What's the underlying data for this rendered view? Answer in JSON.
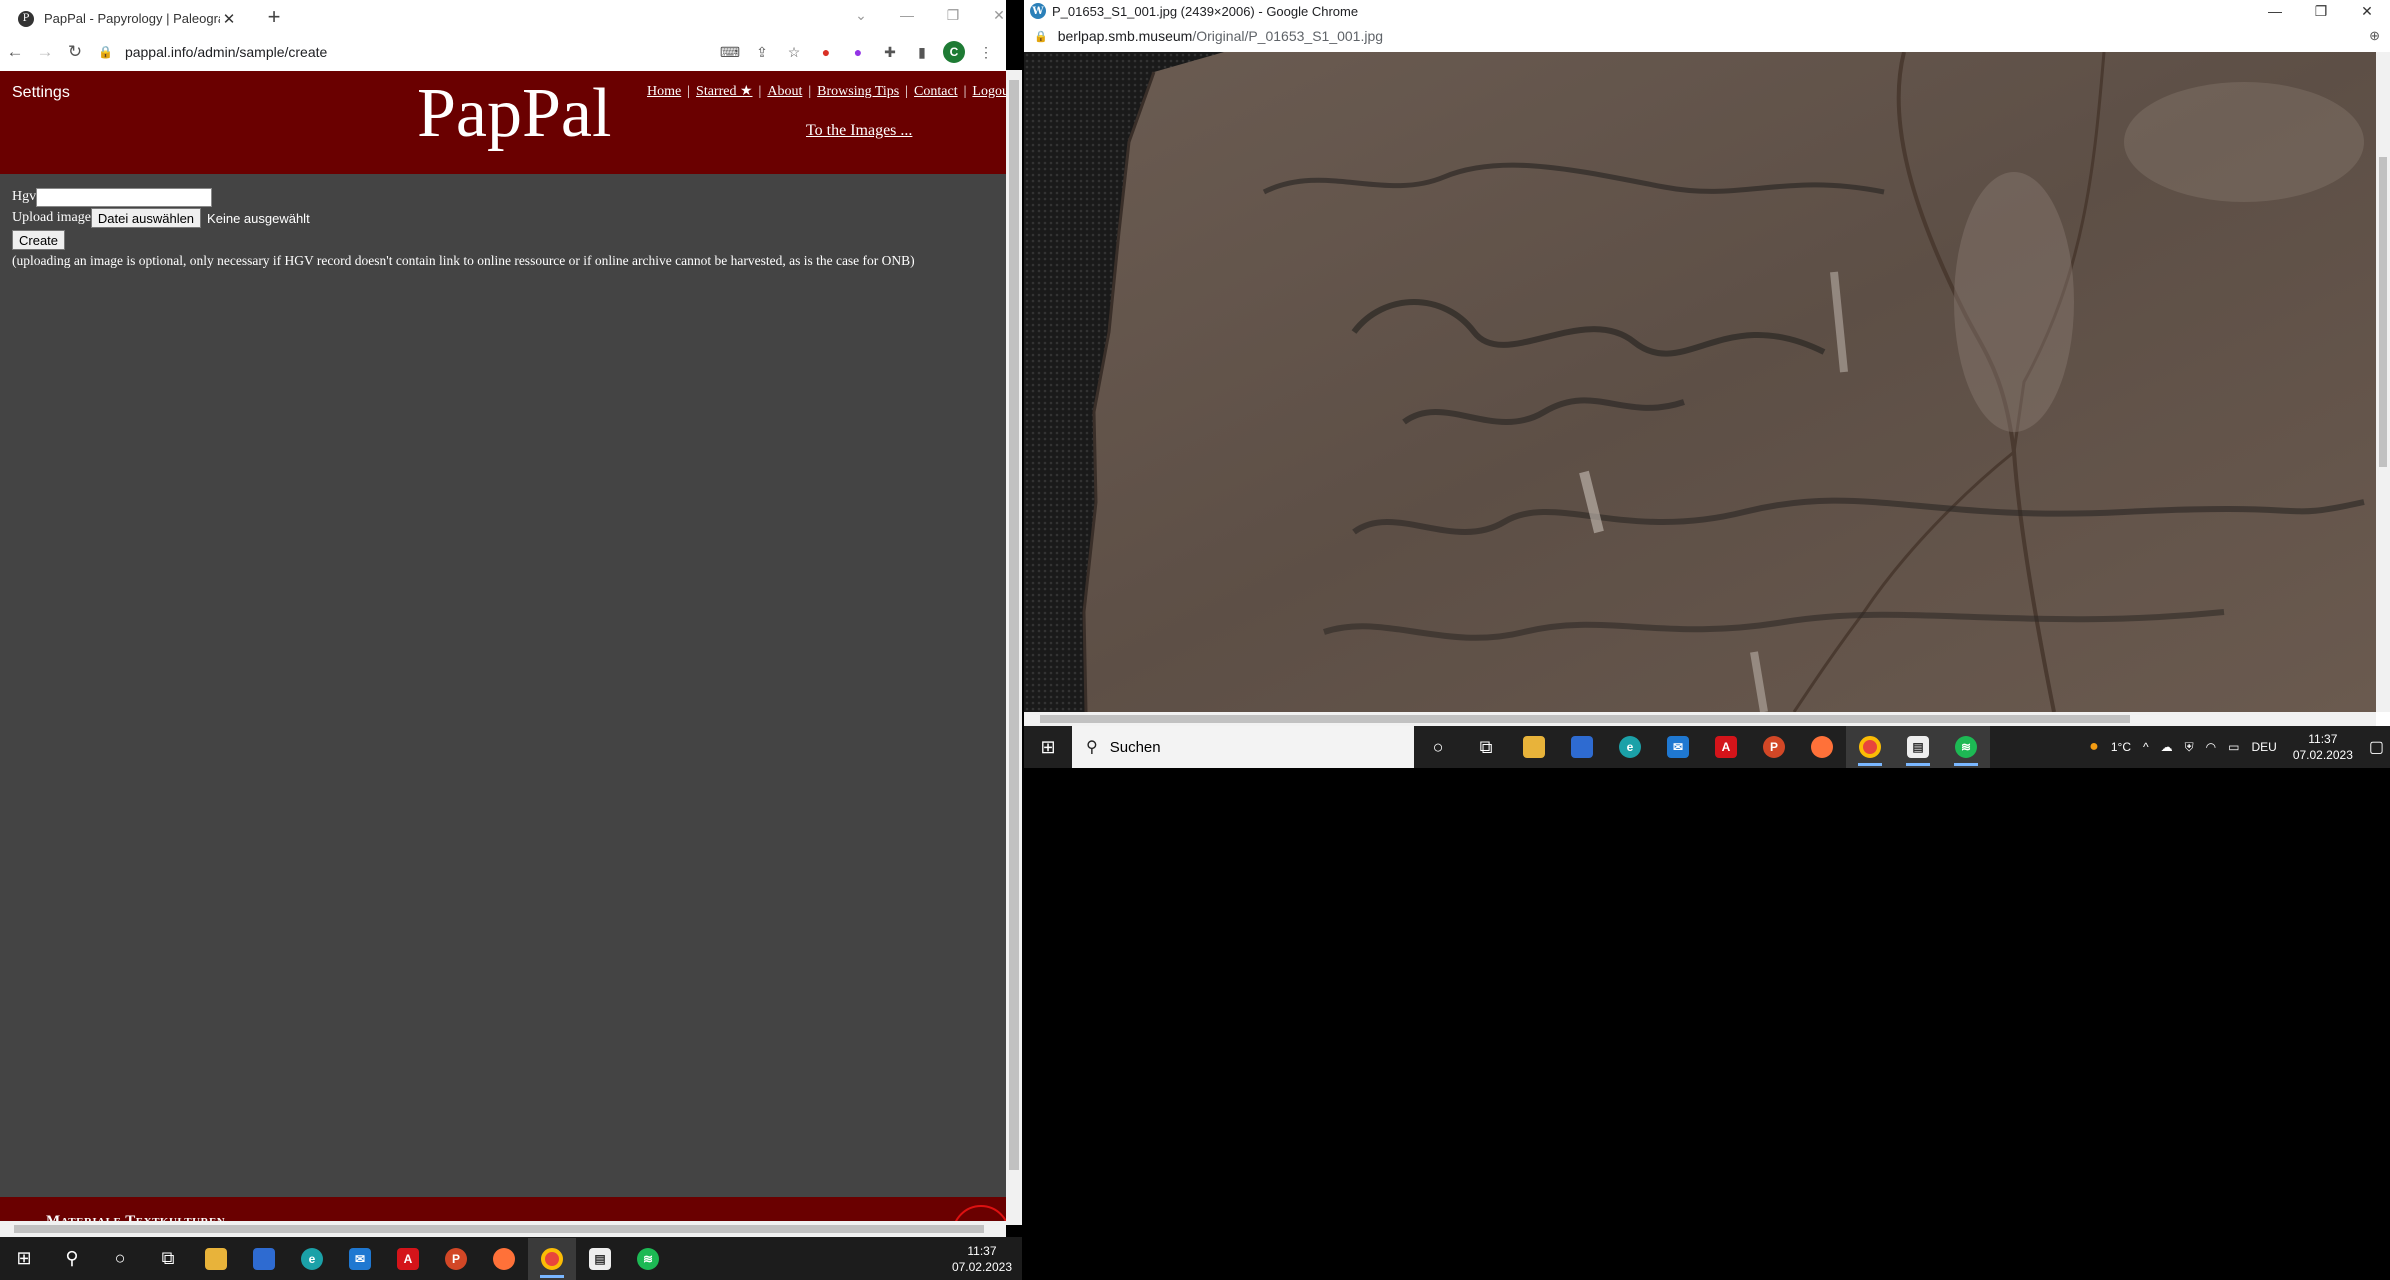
{
  "left_window": {
    "tab_title": "PapPal - Papyrology | Paleograph",
    "url": "pappal.info/admin/sample/create",
    "header": {
      "settings": "Settings",
      "logo": "PapPal",
      "nav": [
        "Home",
        "Starred ★",
        "About",
        "Browsing Tips",
        "Contact",
        "Logout"
      ],
      "to_images": "To the Images ..."
    },
    "form": {
      "hgv_label": "Hgv",
      "hgv_value": "",
      "upload_label": "Upload image",
      "file_button": "Datei auswählen",
      "file_status": "Keine ausgewählt",
      "create_button": "Create",
      "note": "(uploading an image is optional, only necessary if HGV record doesn't contain link to online ressource or if online archive cannot be harvested, as is the case for ONB)"
    },
    "footer_text": "Materiale Textkulturen"
  },
  "right_window": {
    "title": "P_01653_S1_001.jpg (2439×2006) - Google Chrome",
    "url_host": "berlpap.smb.museum",
    "url_path": "/Original/P_01653_S1_001.jpg"
  },
  "taskbar_left": {
    "time": "11:37",
    "date": "07.02.2023"
  },
  "taskbar_right": {
    "search_placeholder": "Suchen",
    "weather": "1°C",
    "language": "DEU",
    "time": "11:37",
    "date": "07.02.2023"
  },
  "colors": {
    "header_red": "#6a0000",
    "page_bg": "#444444",
    "taskbar": "#1c1c1c"
  }
}
